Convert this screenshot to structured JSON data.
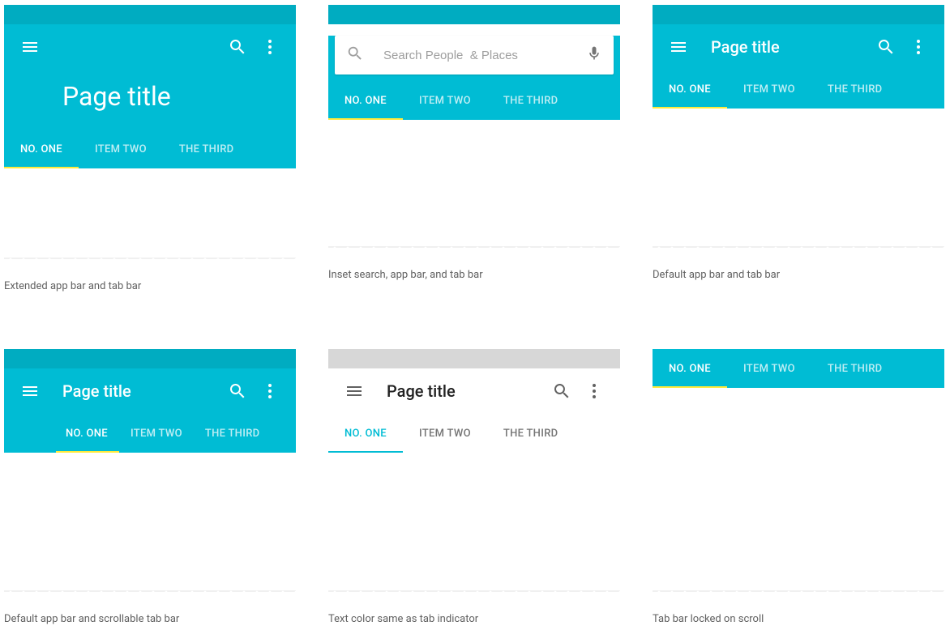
{
  "common": {
    "page_title": "Page title",
    "tabs": [
      "NO. ONE",
      "ITEM TWO",
      "THE THIRD"
    ]
  },
  "search": {
    "placeholder": "Search People  & Places"
  },
  "captions": {
    "a": "Extended app bar and tab bar",
    "b": "Inset search, app bar, and tab bar",
    "c": "Default app bar and tab bar",
    "d": "Default app bar and scrollable tab bar",
    "e": "Text color same as tab indicator",
    "f": "Tab bar locked on scroll"
  },
  "colors": {
    "primary": "#00bcd4",
    "primary_dark": "#00acc1",
    "accent_yellow": "#ffeb3b"
  }
}
